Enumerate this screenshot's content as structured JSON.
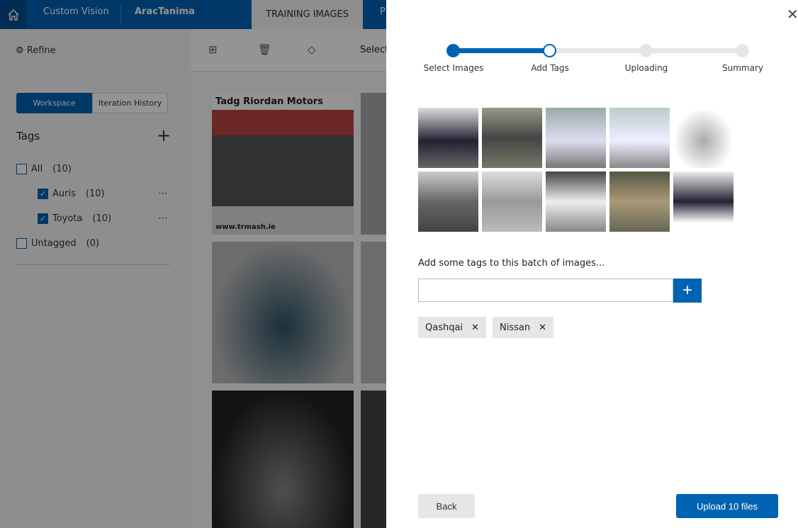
{
  "header": {
    "app": "Custom Vision",
    "project": "AracTanima",
    "tab_training": "TRAINING IMAGES",
    "tab_next": "P"
  },
  "sidebar": {
    "refine": "Refine",
    "seg_workspace": "Workspace",
    "seg_history": "Iteration History",
    "tags_title": "Tags",
    "tags": [
      {
        "label": "All",
        "count": "(10)",
        "checked": false
      },
      {
        "label": "Auris",
        "count": "(10)",
        "checked": true
      },
      {
        "label": "Toyota",
        "count": "(10)",
        "checked": true
      },
      {
        "label": "Untagged",
        "count": "(0)",
        "checked": false
      }
    ]
  },
  "toolbar": {
    "select": "Select"
  },
  "tiles": {
    "dealer": "Tadg Riordan Motors",
    "url": "www.trmash.ie"
  },
  "dialog": {
    "steps": [
      "Select Images",
      "Add Tags",
      "Uploading",
      "Summary"
    ],
    "current_step": 2,
    "tag_prompt": "Add some tags to this batch of images...",
    "tag_input_value": "",
    "tag_input_placeholder": "",
    "chips": [
      "Qashqai",
      "Nissan"
    ],
    "back": "Back",
    "upload": "Upload 10 files",
    "image_count": 10
  },
  "colors": {
    "accent": "#0063b1"
  }
}
